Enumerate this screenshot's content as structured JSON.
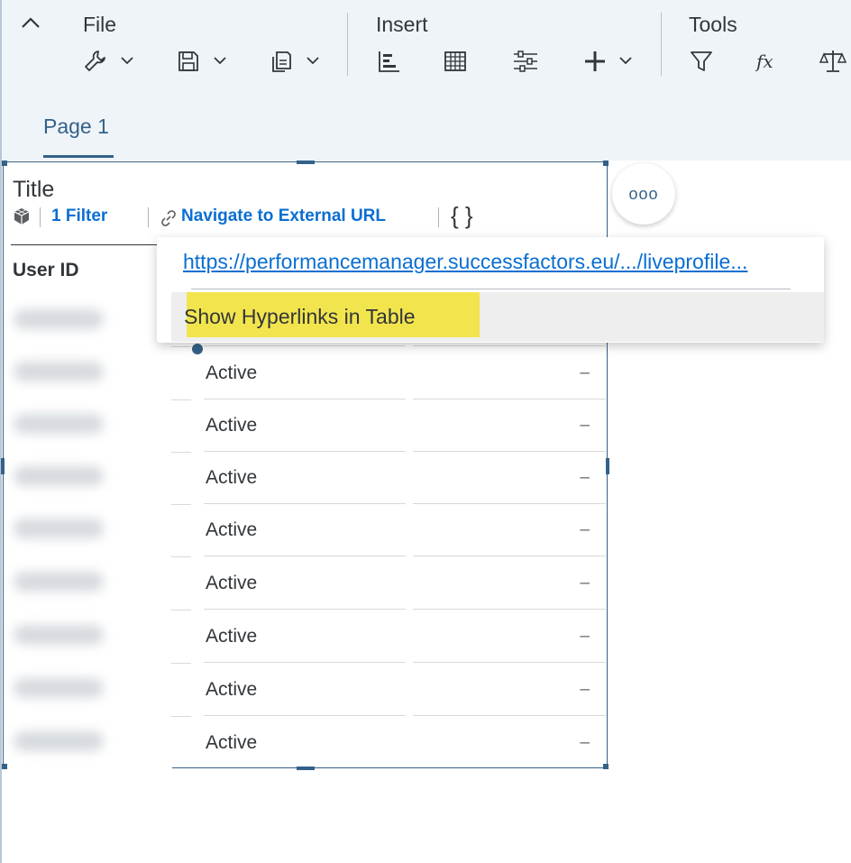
{
  "toolbar": {
    "groups": [
      {
        "label": "File"
      },
      {
        "label": "Insert"
      },
      {
        "label": "Tools"
      }
    ],
    "icons": [
      "chevron-up-icon",
      "wrench-icon",
      "save-icon",
      "copy-icon",
      "chart-icon",
      "table-icon",
      "input-control-icon",
      "add-icon",
      "filter-icon",
      "formula-icon",
      "balance-icon"
    ]
  },
  "tabs": [
    {
      "label": "Page 1"
    }
  ],
  "widget": {
    "title": "Title",
    "filter_label": "1 Filter",
    "nav_link_label": "Navigate to External URL",
    "braces": "{ }",
    "column_header": "User ID",
    "rows": [
      {
        "status": "",
        "value": ""
      },
      {
        "status": "Active",
        "value": "–"
      },
      {
        "status": "Active",
        "value": "–"
      },
      {
        "status": "Active",
        "value": "–"
      },
      {
        "status": "Active",
        "value": "–"
      },
      {
        "status": "Active",
        "value": "–"
      },
      {
        "status": "Active",
        "value": "–"
      },
      {
        "status": "Active",
        "value": "–"
      },
      {
        "status": "Active",
        "value": "–"
      }
    ]
  },
  "more_button": {
    "label": "ooo"
  },
  "popover": {
    "url": "https://performancemanager.successfactors.eu/.../liveprofile...",
    "item_label": "Show Hyperlinks in Table"
  },
  "colors": {
    "accent": "#346187",
    "link": "#0a6ed1",
    "toolbar_bg": "#eff4f9",
    "highlight": "#f2e44c"
  }
}
